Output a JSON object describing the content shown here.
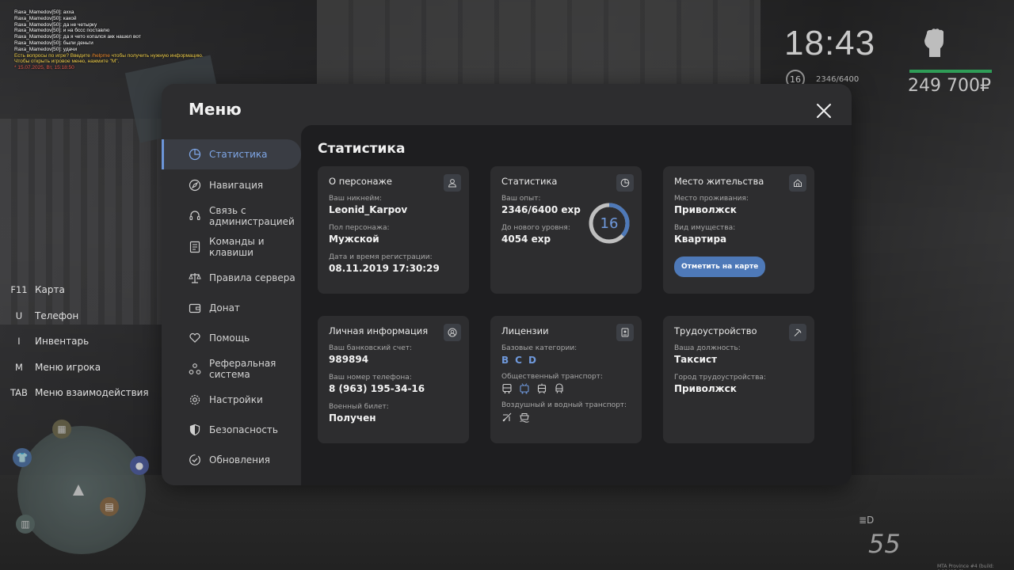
{
  "chat": {
    "lines": [
      "Raxa_Mamedov[50]: ахха",
      "Raxa_Mamedov[50]: какой",
      "Raxa_Mamedov[50]: да не четырку",
      "Raxa_Mamedov[50]: и на бссс поставлю",
      "Raxa_Mamedov[50]: да я чето копался акк нашел вот",
      "Raxa_Mamedov[50]: были деньги",
      "Raxa_Mamedov[50]: удачи"
    ],
    "system_prefix": "Есть вопросы по игре? Введите",
    "system_cmd": "/helpme",
    "system_suffix": "чтобы получить нужную информацию.",
    "menu_hint": "Чтобы открыть игровое меню, нажмите \"M\".",
    "date": "* 15.07.2025, Вт, 15:18:50"
  },
  "hud": {
    "time": "18:43",
    "level": "16",
    "exp": "2346/6400",
    "money": "249 700₽",
    "speed": "55",
    "build": "MTA Province #4 (build: 0.12413.6)"
  },
  "hotkeys": [
    {
      "key": "F11",
      "label": "Карта"
    },
    {
      "key": "U",
      "label": "Телефон"
    },
    {
      "key": "I",
      "label": "Инвентарь"
    },
    {
      "key": "M",
      "label": "Меню игрока"
    },
    {
      "key": "TAB",
      "label": "Меню взаимодействия"
    }
  ],
  "menu": {
    "title": "Меню",
    "nav": [
      {
        "label": "Статистика",
        "icon": "pie-chart-icon",
        "active": true
      },
      {
        "label": "Навигация",
        "icon": "compass-icon"
      },
      {
        "label": "Связь с администрацией",
        "icon": "headset-icon"
      },
      {
        "label": "Команды и клавиши",
        "icon": "keyboard-doc-icon"
      },
      {
        "label": "Правила сервера",
        "icon": "scales-icon"
      },
      {
        "label": "Донат",
        "icon": "wallet-icon"
      },
      {
        "label": "Помощь",
        "icon": "heart-hand-icon"
      },
      {
        "label": "Реферальная система",
        "icon": "referral-icon"
      },
      {
        "label": "Настройки",
        "icon": "gear-icon"
      },
      {
        "label": "Безопасность",
        "icon": "shield-icon"
      },
      {
        "label": "Обновления",
        "icon": "check-circle-icon"
      }
    ],
    "content_title": "Статистика",
    "cards": {
      "character": {
        "title": "О персонаже",
        "nickname_label": "Ваш никнейм:",
        "nickname": "Leonid_Karpov",
        "gender_label": "Пол персонажа:",
        "gender": "Мужской",
        "reg_label": "Дата и время регистрации:",
        "reg": "08.11.2019 17:30:29"
      },
      "stats": {
        "title": "Статистика",
        "exp_label": "Ваш опыт:",
        "exp": "2346/6400 exp",
        "next_label": "До нового уровня:",
        "next": "4054 exp",
        "level": "16",
        "progress": 0.3666
      },
      "residence": {
        "title": "Место жительства",
        "place_label": "Место проживания:",
        "place": "Приволжск",
        "property_label": "Вид имущества:",
        "property": "Квартира",
        "button": "Отметить на карте"
      },
      "personal": {
        "title": "Личная информация",
        "bank_label": "Ваш банковский счет:",
        "bank": "989894",
        "phone_label": "Ваш номер телефона:",
        "phone": "8 (963) 195-34-16",
        "military_label": "Военный билет:",
        "military": "Получен"
      },
      "licenses": {
        "title": "Лицензии",
        "base_label": "Базовые категории:",
        "base": [
          "B",
          "C",
          "D"
        ],
        "public_label": "Общественный транспорт:",
        "air_label": "Воздушный и водный транспорт:"
      },
      "job": {
        "title": "Трудоустройство",
        "position_label": "Ваша должность:",
        "position": "Таксист",
        "city_label": "Город трудоустройства:",
        "city": "Приволжск"
      }
    }
  },
  "colors": {
    "accent": "#6c95d8",
    "button": "#4e79b8",
    "panel": "#2d2d2f",
    "content": "#1e1e20",
    "money_bar": "#2f9d57"
  }
}
